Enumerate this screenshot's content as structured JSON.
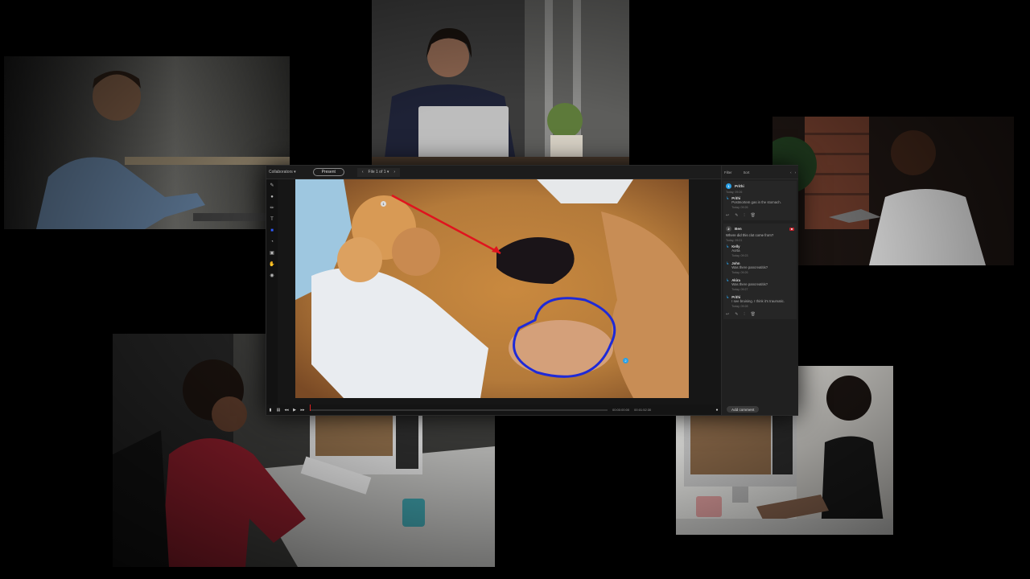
{
  "app": {
    "collaborators_label": "Collaborators ▾",
    "present_label": "Present",
    "file_label": "File 1 of 1 ▾",
    "filter_label": "Filter",
    "sort_label": "Sort",
    "timecode_current": "00:00:00:00",
    "timecode_total": "00:01:52:30",
    "add_comment_label": "Add comment",
    "playback_progress": 0.0
  },
  "comments": [
    {
      "number": "1",
      "author": "Prithi",
      "time": "Today, 09:26",
      "reply_author": "Prithi",
      "reply_text": "Postmortem gas in the stomach.",
      "reply_time": "Today, 09:26"
    },
    {
      "number": "2",
      "author": "Ben",
      "question": "Where did this clot come from?",
      "time": "Today, 09:21",
      "replies": [
        {
          "author": "Kelly",
          "text": "Aorta",
          "time": "Today, 09:23"
        },
        {
          "author": "John",
          "text": "Was there pancreatitis?",
          "time": "Today, 09:26"
        },
        {
          "author": "Akira",
          "text": "Was there pancreatitis?",
          "time": "Today, 09:27"
        },
        {
          "author": "Prithi",
          "text": "I see bruising. I think it's traumatic.",
          "time": "Today, 09:28"
        }
      ]
    }
  ],
  "colors": {
    "accent": "#2aa0e6",
    "annotation_arrow": "#e0141e",
    "annotation_circle": "#1e2ad8",
    "badge": "#c0212a"
  },
  "icons": [
    "pencil-icon",
    "pen-icon",
    "brush-icon",
    "text-icon",
    "square-icon",
    "shape-icon",
    "crop-icon",
    "hand-icon",
    "eye-icon",
    "play-icon",
    "rewind-icon",
    "forward-icon",
    "reply-icon",
    "edit-icon",
    "delete-icon"
  ]
}
